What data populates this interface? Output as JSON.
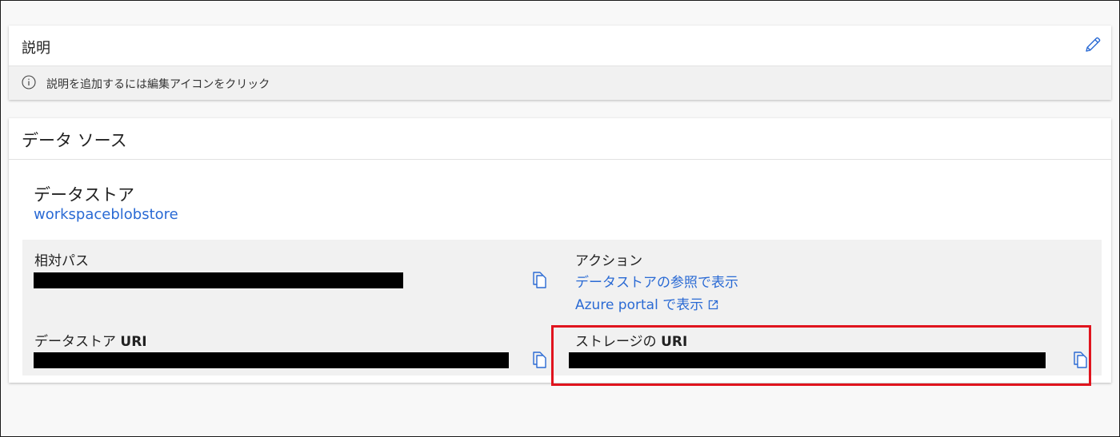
{
  "description": {
    "title": "説明",
    "info_text": "説明を追加するには編集アイコンをクリック",
    "edit_icon": "pencil-icon",
    "info_icon": "info-circle-icon"
  },
  "data_source": {
    "title": "データ ソース",
    "datastore_label": "データストア",
    "datastore_link": "workspaceblobstore",
    "relative_path": {
      "label": "相対パス",
      "value_redacted": true
    },
    "actions": {
      "label": "アクション",
      "browse_link": "データストアの参照で表示",
      "portal_link": "Azure portal で表示",
      "portal_icon": "external-link-icon"
    },
    "datastore_uri": {
      "label_prefix": "データストア ",
      "label_bold": "URI",
      "value_redacted": true
    },
    "storage_uri": {
      "label_prefix": "ストレージの ",
      "label_bold": "URI",
      "value_redacted": true
    },
    "copy_icon": "copy-icon"
  },
  "colors": {
    "link": "#2a6ad4",
    "highlight": "#e0141e",
    "panel": "#f1f1f1"
  }
}
